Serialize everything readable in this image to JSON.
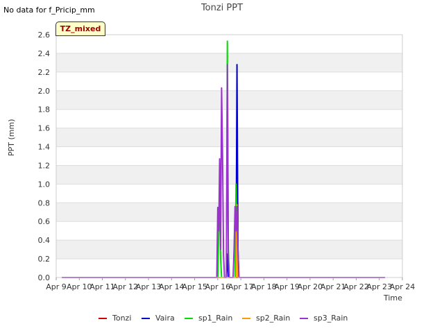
{
  "header": {
    "nodata_text": "No data for f_Pricip_mm",
    "title": "Tonzi PPT",
    "badge": "TZ_mixed"
  },
  "chart_data": {
    "type": "line",
    "title": "Tonzi PPT",
    "xlabel": "Time",
    "ylabel": "PPT (mm)",
    "xlim": [
      "2024-04-09",
      "2024-04-24"
    ],
    "ylim": [
      0,
      2.6
    ],
    "x_ticks": [
      "Apr 9",
      "Apr 10",
      "Apr 11",
      "Apr 12",
      "Apr 13",
      "Apr 14",
      "Apr 15",
      "Apr 16",
      "Apr 17",
      "Apr 18",
      "Apr 19",
      "Apr 20",
      "Apr 21",
      "Apr 22",
      "Apr 23",
      "Apr 24"
    ],
    "y_ticks": [
      "0.0",
      "0.2",
      "0.4",
      "0.6",
      "0.8",
      "1.0",
      "1.2",
      "1.4",
      "1.6",
      "1.8",
      "2.0",
      "2.2",
      "2.4",
      "2.6"
    ],
    "grid": true,
    "legend_position": "bottom",
    "series": [
      {
        "name": "Tonzi",
        "color": "#cc0000",
        "points": [
          [
            "2024-04-09 06:00",
            0
          ],
          [
            "2024-04-23 06:00",
            0
          ]
        ]
      },
      {
        "name": "Vaira",
        "color": "#0000cc",
        "points": [
          [
            "2024-04-09 06:00",
            0
          ],
          [
            "2024-04-16 09:00",
            0
          ],
          [
            "2024-04-16 10:00",
            0.25
          ],
          [
            "2024-04-16 11:00",
            0
          ],
          [
            "2024-04-16 19:00",
            0
          ],
          [
            "2024-04-16 20:00",
            2.28
          ],
          [
            "2024-04-16 21:00",
            0.3
          ],
          [
            "2024-04-16 22:00",
            0
          ],
          [
            "2024-04-23 06:00",
            0
          ]
        ]
      },
      {
        "name": "sp1_Rain",
        "color": "#00dd00",
        "points": [
          [
            "2024-04-09 06:00",
            0
          ],
          [
            "2024-04-16 00:00",
            0
          ],
          [
            "2024-04-16 01:00",
            0.5
          ],
          [
            "2024-04-16 02:00",
            1.0
          ],
          [
            "2024-04-16 03:00",
            0.2
          ],
          [
            "2024-04-16 04:00",
            0
          ],
          [
            "2024-04-16 09:00",
            0
          ],
          [
            "2024-04-16 10:00",
            2.53
          ],
          [
            "2024-04-16 11:00",
            0.3
          ],
          [
            "2024-04-16 12:00",
            0
          ],
          [
            "2024-04-16 18:00",
            0
          ],
          [
            "2024-04-16 19:00",
            1.0
          ],
          [
            "2024-04-16 20:00",
            0.5
          ],
          [
            "2024-04-16 21:00",
            0.2
          ],
          [
            "2024-04-16 22:00",
            0
          ],
          [
            "2024-04-23 06:00",
            0
          ]
        ]
      },
      {
        "name": "sp2_Rain",
        "color": "#ff9900",
        "points": [
          [
            "2024-04-09 06:00",
            0
          ],
          [
            "2024-04-16 19:00",
            0
          ],
          [
            "2024-04-16 20:00",
            0.78
          ],
          [
            "2024-04-16 21:00",
            0
          ],
          [
            "2024-04-23 06:00",
            0
          ]
        ]
      },
      {
        "name": "sp3_Rain",
        "color": "#9933cc",
        "points": [
          [
            "2024-04-09 06:00",
            0
          ],
          [
            "2024-04-15 23:00",
            0
          ],
          [
            "2024-04-16 00:00",
            0.75
          ],
          [
            "2024-04-16 01:00",
            0.5
          ],
          [
            "2024-04-16 02:00",
            1.27
          ],
          [
            "2024-04-16 03:00",
            0.3
          ],
          [
            "2024-04-16 04:00",
            2.03
          ],
          [
            "2024-04-16 05:00",
            1.3
          ],
          [
            "2024-04-16 06:00",
            0.25
          ],
          [
            "2024-04-16 07:00",
            0
          ],
          [
            "2024-04-16 09:00",
            0
          ],
          [
            "2024-04-16 10:00",
            2.28
          ],
          [
            "2024-04-16 11:00",
            0.25
          ],
          [
            "2024-04-16 12:00",
            0
          ],
          [
            "2024-04-16 16:00",
            0
          ],
          [
            "2024-04-16 17:00",
            0.3
          ],
          [
            "2024-04-16 18:00",
            0.76
          ],
          [
            "2024-04-16 19:00",
            0.5
          ],
          [
            "2024-04-16 20:00",
            0.76
          ],
          [
            "2024-04-16 21:00",
            0.3
          ],
          [
            "2024-04-16 22:00",
            0
          ],
          [
            "2024-04-23 06:00",
            0
          ]
        ]
      }
    ]
  }
}
